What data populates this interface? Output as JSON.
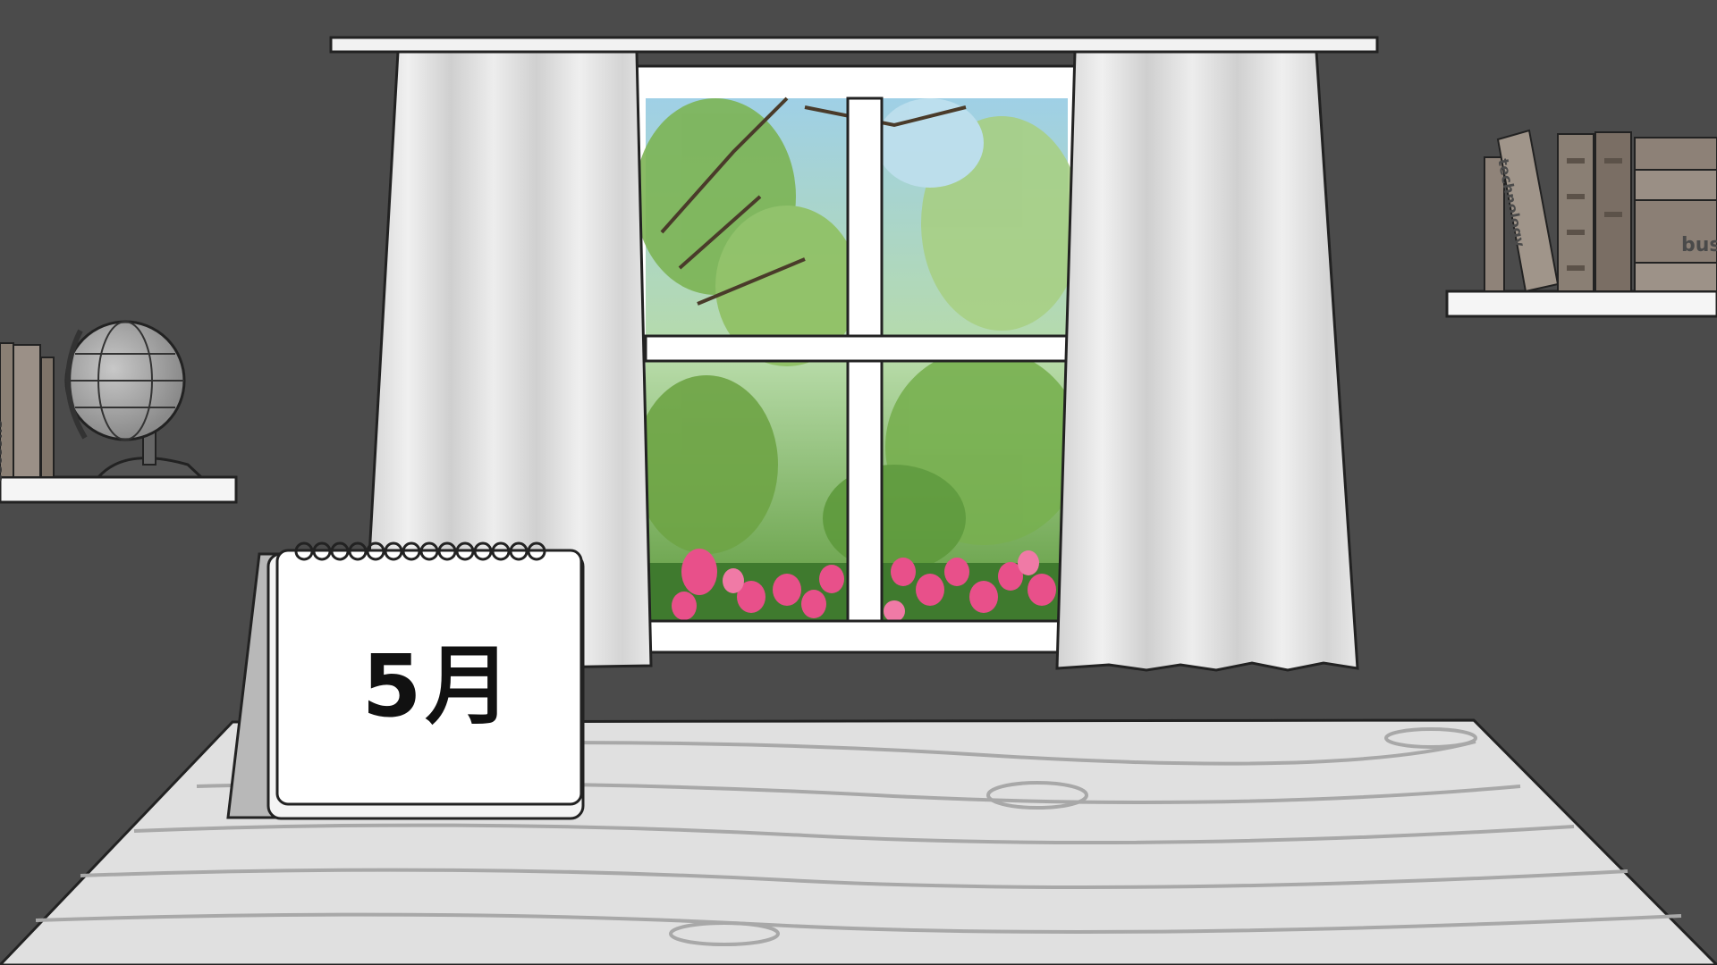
{
  "calendar": {
    "month_label": "5月"
  },
  "books_left": {
    "spine_label": "success"
  },
  "books_right": {
    "spine_label_1": "technology",
    "spine_label_2": "bus"
  },
  "colors": {
    "wall": "#4b4b4b",
    "desk": "#e0e0e0",
    "curtain": "#e2e2e2",
    "tulip": "#e8508a",
    "foliage": "#6fa84a",
    "sky": "#a9d4e6"
  }
}
